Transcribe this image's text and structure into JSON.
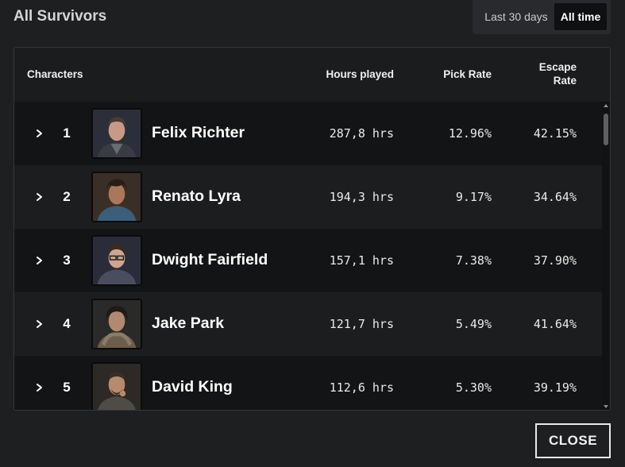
{
  "header": {
    "title": "All Survivors"
  },
  "range": {
    "last30": "Last 30 days",
    "alltime": "All time",
    "selected": "All time"
  },
  "table": {
    "columns": {
      "characters": "Characters",
      "hours": "Hours played",
      "pick": "Pick Rate",
      "escape_line1": "Escape",
      "escape_line2": "Rate"
    },
    "rows": [
      {
        "rank": "1",
        "name": "Felix Richter",
        "hours": "287,8 hrs",
        "pick": "12.96%",
        "escape": "42.15%"
      },
      {
        "rank": "2",
        "name": "Renato Lyra",
        "hours": "194,3 hrs",
        "pick": "9.17%",
        "escape": "34.64%"
      },
      {
        "rank": "3",
        "name": "Dwight Fairfield",
        "hours": "157,1 hrs",
        "pick": "7.38%",
        "escape": "37.90%"
      },
      {
        "rank": "4",
        "name": "Jake Park",
        "hours": "121,7 hrs",
        "pick": "5.49%",
        "escape": "41.64%"
      },
      {
        "rank": "5",
        "name": "David King",
        "hours": "112,6 hrs",
        "pick": "5.30%",
        "escape": "39.19%"
      }
    ]
  },
  "footer": {
    "close_label": "CLOSE"
  }
}
